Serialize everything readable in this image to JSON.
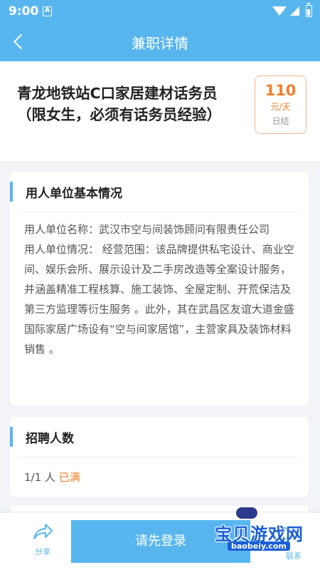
{
  "status_bar": {
    "time": "9:00",
    "notification_icon_label": "A"
  },
  "nav": {
    "title": "兼职详情"
  },
  "job": {
    "title": "青龙地铁站C口家居建材话务员（限女生，必须有话务员经验）",
    "salary": {
      "amount": "110",
      "unit": "元/天",
      "settlement": "日结"
    }
  },
  "employer_section": {
    "heading": "用人单位基本情况",
    "name_line": "用人单位名称：武汉市空与间装饰顾问有限责任公司",
    "info_line": "用人单位情况： 经营范围：该品牌提供私宅设计、商业空间、娱乐会所、展示设计及二手房改造等全案设计服务，并涵盖精准工程核算、施工装饰、全屋定制、开荒保洁及第三方监理等衍生服务 。此外，其在武昌区友谊大道金盛国际家居广场设有“空与间家居馆”，主营家具及装饰材料销售 。"
  },
  "recruit_section": {
    "heading": "招聘人数",
    "count": "1/1 人",
    "status": "已满"
  },
  "bottom_bar": {
    "share_label": "分享",
    "login_label": "请先登录",
    "contact_label": "联系"
  },
  "watermark": {
    "title": "宝贝游戏网",
    "url": "baobeiy.com"
  },
  "colors": {
    "primary": "#58b6ee",
    "accent": "#f07f2a"
  }
}
